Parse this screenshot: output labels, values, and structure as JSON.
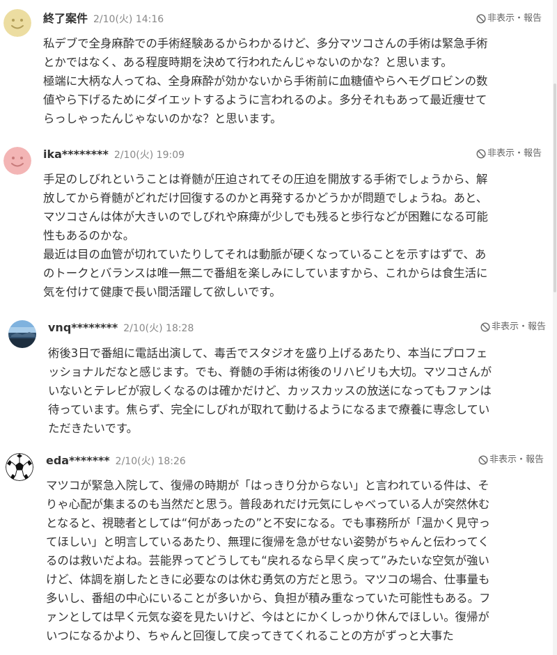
{
  "report_label": "非表示・報告",
  "comments": [
    {
      "user": "終了案件",
      "time": "2/10(火) 14:16",
      "avatar": "smiley-yellow",
      "lines": [
        "私デブで全身麻酔での手術経験あるからわかるけど、多分マツコさんの手術は緊急手術",
        "とかではなく、ある程度時期を決めて行われたんじゃないのかな？と思います。",
        "極端に大柄な人ってね、全身麻酔が効かないから手術前に血糖値やらヘモグロビンの数",
        "値やら下げるためにダイエットするように言われるのよ。多分それもあって最近痩せて",
        "らっしゃったんじゃないのかな？と思います。"
      ]
    },
    {
      "user": "ika********",
      "time": "2/10(火) 19:09",
      "avatar": "smiley-pink",
      "lines": [
        "手足のしびれということは脊髄が圧迫されてその圧迫を開放する手術でしょうから、解",
        "放してから脊髄がどれだけ回復するのかと再発するかどうかが問題でしょうね。あと、",
        "マツコさんは体が大きいのでしびれや麻痺が少しでも残ると歩行などが困難になる可能",
        "性もあるのかな。",
        "最近は目の血管が切れていたりしてそれは動脈が硬くなっていることを示すはずで、あ",
        "のトークとバランスは唯一無二で番組を楽しみにしていますから、これからは食生活に",
        "気を付けて健康で長い間活躍して欲しいです。"
      ]
    },
    {
      "user": "vnq********",
      "time": "2/10(火) 18:28",
      "avatar": "landscape-photo",
      "lines": [
        "術後3日で番組に電話出演して、毒舌でスタジオを盛り上げるあたり、本当にプロフェ",
        "ッショナルだなと感じます。でも、脊髄の手術は術後のリハビリも大切。マツコさんが",
        "いないとテレビが寂しくなるのは確かだけど、カッスカッスの放送になってもファンは",
        "待っています。焦らず、完全にしびれが取れて動けるようになるまで療養に専念してい",
        "ただきたいです。"
      ]
    },
    {
      "user": "eda*******",
      "time": "2/10(火) 18:26",
      "avatar": "soccer-ball",
      "lines": [
        "マツコが緊急入院して、復帰の時期が「はっきり分からない」と言われている件は、そ",
        "りゃ心配が集まるのも当然だと思う。普段あれだけ元気にしゃべっている人が突然休む",
        "となると、視聴者としては“何があったの”と不安になる。でも事務所が「温かく見守っ",
        "てほしい」と明言しているあたり、無理に復帰を急がせない姿勢がちゃんと伝わってく",
        "るのは救いだよね。芸能界ってどうしても“戻れるなら早く戻って”みたいな空気が強い",
        "けど、体調を崩したときに必要なのは休む勇気の方だと思う。マツコの場合、仕事量も",
        "多いし、番組の中心にいることが多いから、負担が積み重なっていた可能性もある。フ",
        "ァンとしては早く元気な姿を見たいけど、今はとにかくしっかり休んでほしい。復帰が",
        "いつになるかより、ちゃんと回復して戻ってきてくれることの方がずっと大事た"
      ]
    }
  ]
}
